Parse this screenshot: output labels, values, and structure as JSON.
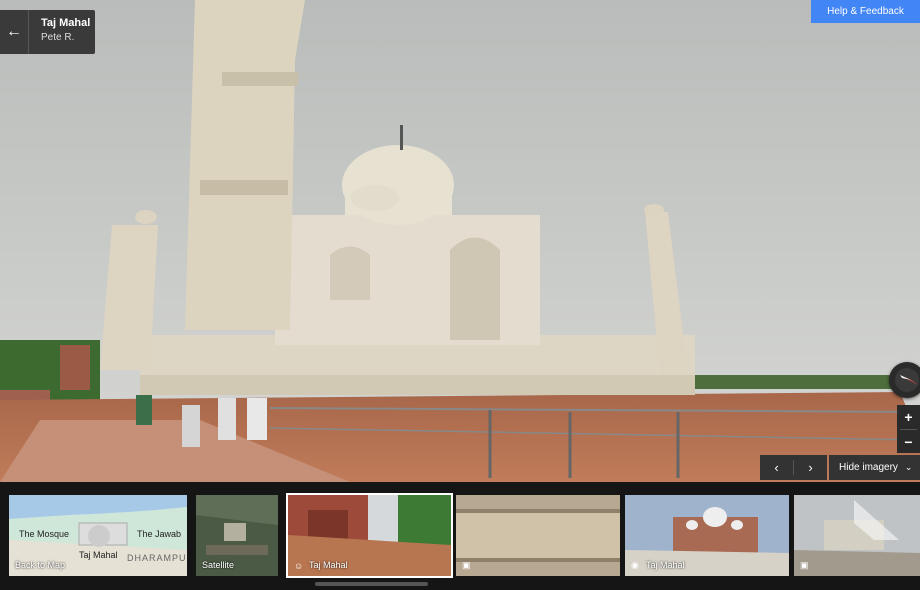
{
  "place": {
    "title": "Taj Mahal",
    "author": "Pete R."
  },
  "help": {
    "label": "Help & Feedback"
  },
  "controls": {
    "back_icon": "←",
    "zoom_in": "+",
    "zoom_out": "−",
    "prev": "‹",
    "next": "›",
    "hide_imagery": "Hide imagery",
    "hide_chevron": "⌄"
  },
  "thumbnails": {
    "map": {
      "label": "Back to Map",
      "labels": [
        "The Mosque",
        "The Jawab",
        "Taj Mahal",
        "DHARAMPU"
      ]
    },
    "satellite": {
      "label": "Satellite"
    },
    "photo1": {
      "label": "Taj Mahal",
      "icon": "☺"
    },
    "photo2": {
      "label": "",
      "icon": "▣"
    },
    "photo3": {
      "label": "Taj Mahal",
      "icon": "◉"
    },
    "photo4": {
      "label": "",
      "icon": "▣"
    }
  },
  "colors": {
    "accent": "#4285f4",
    "sky": "#c9cbc8",
    "marble": "#e2dccb",
    "floor": "#b0704e"
  }
}
